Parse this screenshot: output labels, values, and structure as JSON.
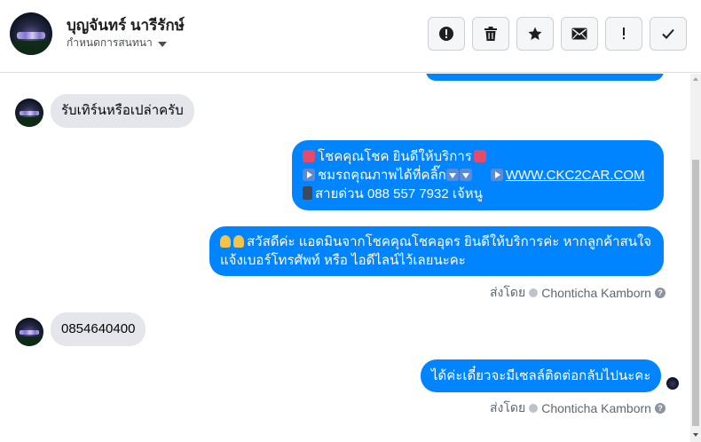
{
  "header": {
    "contact_name": "บุญจันทร์ นารีรักษ์",
    "subtitle": "กำหนดการสนทนา",
    "toolbar": [
      {
        "name": "report-button",
        "icon": "alert-circle-icon"
      },
      {
        "name": "delete-button",
        "icon": "trash-icon"
      },
      {
        "name": "star-button",
        "icon": "star-icon"
      },
      {
        "name": "mark-unread-button",
        "icon": "envelope-icon"
      },
      {
        "name": "important-button",
        "icon": "exclamation-icon"
      },
      {
        "name": "done-button",
        "icon": "checkmark-icon"
      }
    ]
  },
  "messages": [
    {
      "direction": "in",
      "text": "รับเทิร์นหรือเปล่าครับ"
    },
    {
      "direction": "out",
      "line1": "โชคคุณโชค ยินดีให้บริการ",
      "line2": "ชมรถคุณภาพได้ที่คลิ๊ก",
      "link": "WWW.CKC2CAR.COM",
      "line3": "สายด่วน 088 557 7932 เจ้หนู"
    },
    {
      "direction": "out",
      "line1": "สวัสดีค่ะ แอดมินจากโชคคุณโชคอุดร ยินดีให้บริการค่ะ หากลูกค้าสนใจ",
      "line2": "แจ้งเบอร์โทรศัพท์ หรือ ไอดีไลน์ไว้เลยนะคะ"
    },
    {
      "direction": "in",
      "text": "0854640400"
    },
    {
      "direction": "out",
      "text": "ได้ค่ะเดี๋ยวจะมีเซลล์ติดต่อกลับไปนะคะ"
    }
  ],
  "sent_by": {
    "prefix": "ส่งโดย",
    "agent": "Chonticha Kamborn",
    "help": "?"
  },
  "colors": {
    "outgoing_bubble": "#0084ff",
    "incoming_bubble": "#e4e6eb"
  }
}
